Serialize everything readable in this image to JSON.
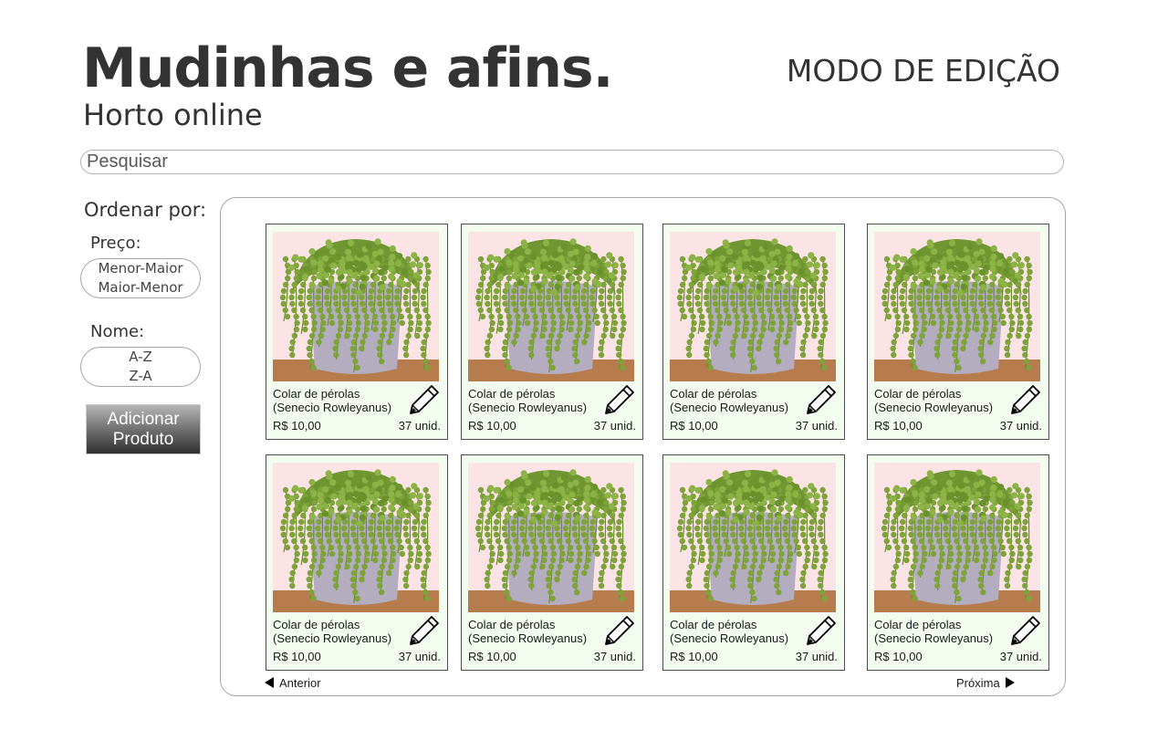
{
  "header": {
    "title": "Mudinhas e afins.",
    "subtitle": "Horto online",
    "mode": "MODO DE EDIÇÃO"
  },
  "search": {
    "placeholder": "Pesquisar",
    "value": ""
  },
  "sidebar": {
    "sort_heading": "Ordenar por:",
    "price_label": "Preço:",
    "price_options": [
      "Menor-Maior",
      "Maior-Menor"
    ],
    "name_label": "Nome:",
    "name_options": [
      "A-Z",
      "Z-A"
    ],
    "add_button_label": "Adicionar\nProduto"
  },
  "products": [
    {
      "name_line1": "Colar de pérolas",
      "name_line2": "(Senecio Rowleyanus)",
      "price": "R$ 10,00",
      "stock": "37 unid."
    },
    {
      "name_line1": "Colar de pérolas",
      "name_line2": "(Senecio Rowleyanus)",
      "price": "R$ 10,00",
      "stock": "37 unid."
    },
    {
      "name_line1": "Colar de pérolas",
      "name_line2": "(Senecio Rowleyanus)",
      "price": "R$ 10,00",
      "stock": "37 unid."
    },
    {
      "name_line1": "Colar de pérolas",
      "name_line2": "(Senecio Rowleyanus)",
      "price": "R$ 10,00",
      "stock": "37 unid."
    },
    {
      "name_line1": "Colar de pérolas",
      "name_line2": "(Senecio Rowleyanus)",
      "price": "R$ 10,00",
      "stock": "37 unid."
    },
    {
      "name_line1": "Colar de pérolas",
      "name_line2": "(Senecio Rowleyanus)",
      "price": "R$ 10,00",
      "stock": "37 unid."
    },
    {
      "name_line1": "Colar de pérolas",
      "name_line2": "(Senecio Rowleyanus)",
      "price": "R$ 10,00",
      "stock": "37 unid."
    },
    {
      "name_line1": "Colar de pérolas",
      "name_line2": "(Senecio Rowleyanus)",
      "price": "R$ 10,00",
      "stock": "37 unid."
    }
  ],
  "pagination": {
    "prev_label": "Anterior",
    "next_label": "Próxima"
  },
  "icons": {
    "edit": "pencil-icon",
    "prev": "triangle-left-icon",
    "next": "triangle-right-icon",
    "product_image": "hanging-plant-pot-image"
  },
  "colors": {
    "text": "#333333",
    "card_background": "#f2fcef",
    "card_border": "#4d4d4d",
    "plant_green": "#7da33a",
    "pot": "#b4acbf",
    "image_background": "#fbe3e6"
  }
}
